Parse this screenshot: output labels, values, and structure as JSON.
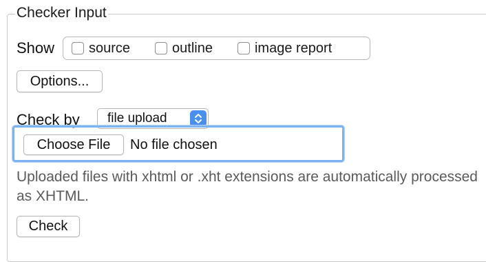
{
  "form": {
    "legend": "Checker Input",
    "show": {
      "label": "Show",
      "options": [
        {
          "label": "source",
          "checked": false
        },
        {
          "label": "outline",
          "checked": false
        },
        {
          "label": "image report",
          "checked": false
        }
      ]
    },
    "options_button": "Options...",
    "check_by": {
      "label": "Check by",
      "selected": "file upload"
    },
    "file_input": {
      "button_label": "Choose File",
      "status": "No file chosen"
    },
    "help_text": "Uploaded files with xhtml or .xht extensions are automatically processed as XHTML.",
    "check_button": "Check"
  },
  "colors": {
    "focus_ring": "#7cb3f0",
    "select_arrow": "#4a8ff0",
    "help_text": "#5a5a5a"
  }
}
